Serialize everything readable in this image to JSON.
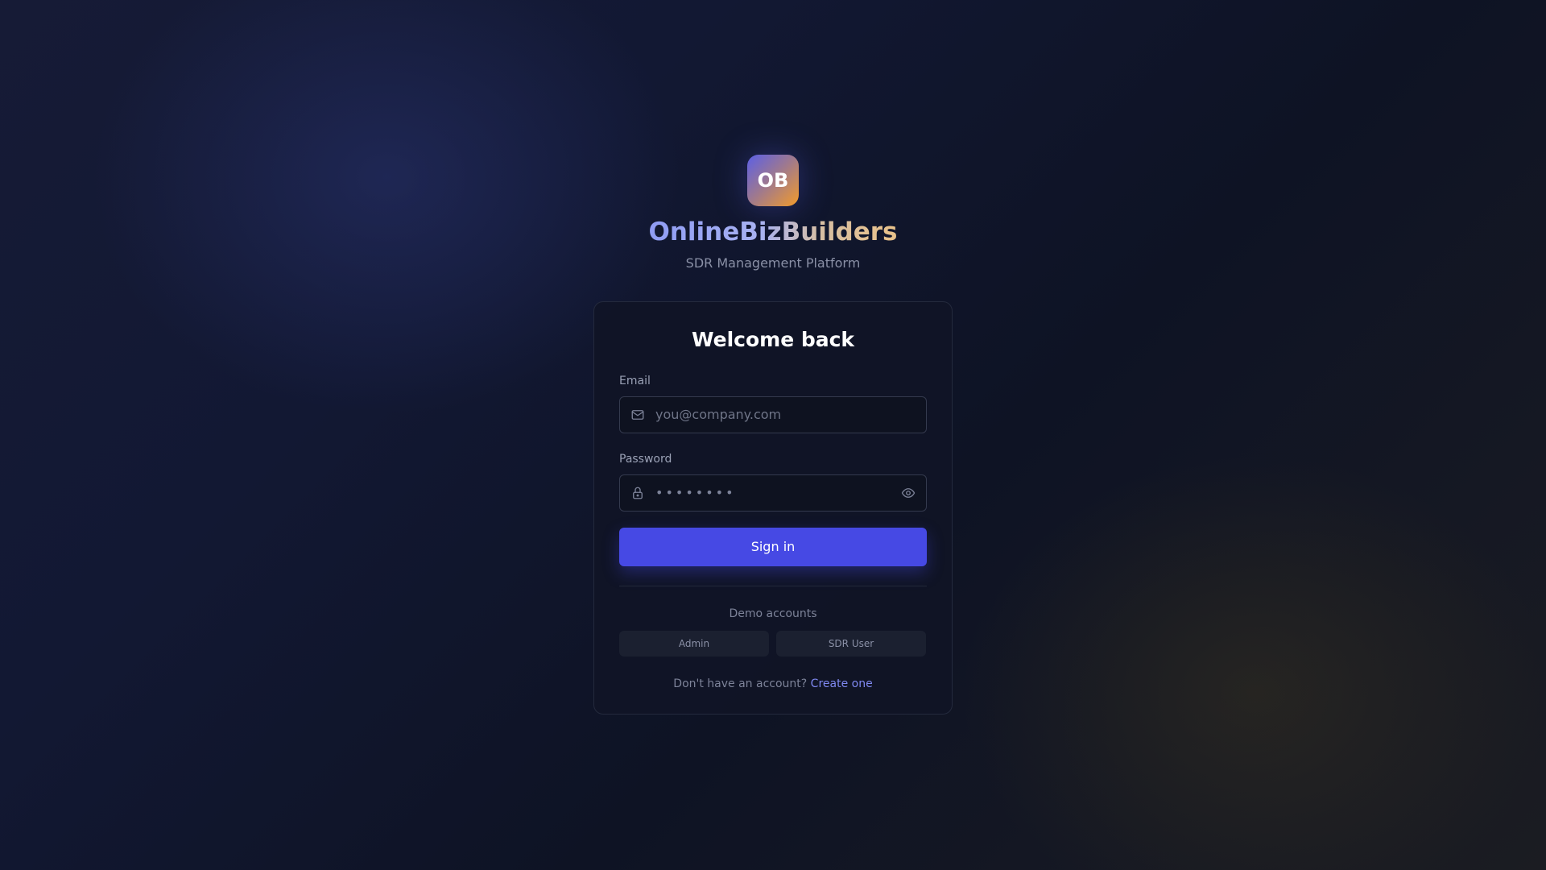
{
  "brand": {
    "logo_text": "OB",
    "name": "OnlineBizBuilders",
    "subtitle": "SDR Management Platform"
  },
  "login": {
    "title": "Welcome back",
    "email_label": "Email",
    "email_placeholder": "you@company.com",
    "email_icon": "mail-icon",
    "password_label": "Password",
    "password_placeholder": "••••••••",
    "password_icon": "lock-icon",
    "password_toggle_icon": "eye-icon",
    "submit_label": "Sign in"
  },
  "demo": {
    "title": "Demo accounts",
    "accounts": [
      "Admin",
      "SDR User"
    ]
  },
  "footer": {
    "prompt": "Don't have an account?",
    "link": "Create one"
  },
  "colors": {
    "accent": "#4649e4",
    "link": "#7f88f0",
    "logo_gradient_start": "#5b5fe6",
    "logo_gradient_end": "#f29b2a"
  }
}
